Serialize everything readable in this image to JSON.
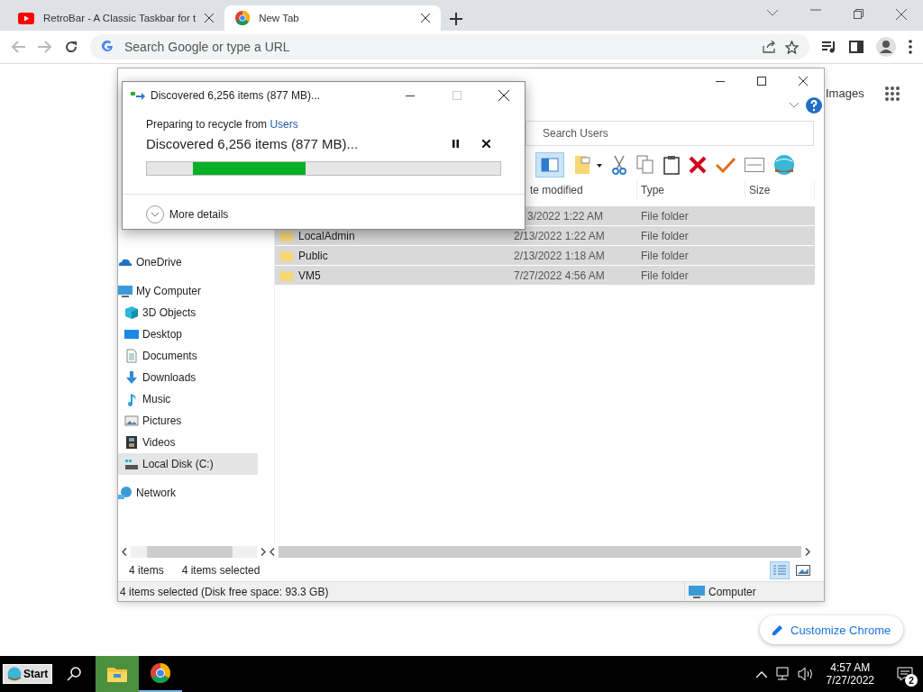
{
  "browser": {
    "tabs": [
      {
        "title": "RetroBar - A Classic Taskbar for t",
        "kind": "video",
        "selected": false
      },
      {
        "title": "New Tab",
        "kind": "browser",
        "selected": true
      }
    ],
    "address_bar": {
      "placeholder": "Search Google or type a URL"
    }
  },
  "page": {
    "link": "Images",
    "customize_button": "Customize Chrome"
  },
  "explorer": {
    "search": {
      "placeholder": "Search Users"
    },
    "columns": [
      "te modified",
      "Type",
      "Size"
    ],
    "rows": [
      {
        "modified": "3/2022 1:22 AM",
        "type": "File folder",
        "selected": true
      },
      {
        "name": "LocalAdmin",
        "modified": "2/13/2022 1:22 AM",
        "type": "File folder",
        "selected": true
      },
      {
        "name": "Public",
        "modified": "2/13/2022 1:18 AM",
        "type": "File folder",
        "selected": true
      },
      {
        "name": "VM5",
        "modified": "7/27/2022 4:56 AM",
        "type": "File folder",
        "selected": true
      }
    ],
    "nav": [
      {
        "label": "OneDrive",
        "kind": "cloud",
        "selected": false
      },
      {
        "label": "My Computer",
        "kind": "computer",
        "selected": false,
        "children": [
          {
            "label": "3D Objects",
            "kind": "cube",
            "selected": false
          },
          {
            "label": "Desktop",
            "kind": "desktop",
            "selected": false
          },
          {
            "label": "Documents",
            "kind": "document",
            "selected": false
          },
          {
            "label": "Downloads",
            "kind": "download",
            "selected": false
          },
          {
            "label": "Music",
            "kind": "music",
            "selected": false
          },
          {
            "label": "Pictures",
            "kind": "pictures",
            "selected": false
          },
          {
            "label": "Videos",
            "kind": "video",
            "selected": false
          },
          {
            "label": "Local Disk (C:)",
            "kind": "drive",
            "selected": true
          }
        ]
      },
      {
        "label": "Network",
        "kind": "network",
        "selected": false
      }
    ],
    "item_count": "4 items",
    "selection_count": "4 items selected",
    "views": [
      {
        "kind": "details",
        "selected": true
      },
      {
        "kind": "preview",
        "selected": false
      }
    ],
    "status_bar": {
      "text": "4 items selected (Disk free space: 93.3 GB)",
      "location": "Computer"
    }
  },
  "dialog": {
    "title": "Discovered 6,256 items (877 MB)...",
    "maximize_disabled": true,
    "message": "Preparing to recycle from ",
    "link": "Users",
    "status": "Discovered 6,256 items (877 MB)...",
    "level": 0.32,
    "more_details": "More details"
  },
  "taskbar": {
    "start": "Start",
    "apps": [
      {
        "kind": "explorer",
        "selected": true
      },
      {
        "kind": "browser",
        "selected": false
      }
    ],
    "time": "4:57 AM",
    "date": "7/27/2022",
    "notifications": "2"
  }
}
